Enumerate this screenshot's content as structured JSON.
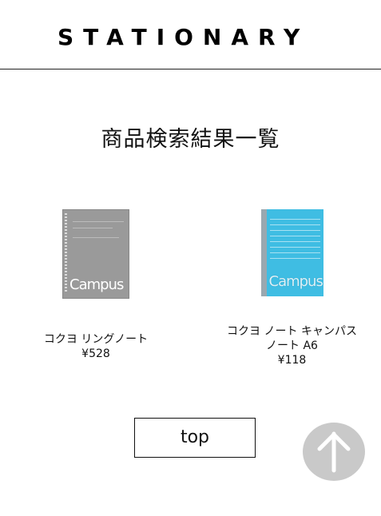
{
  "header": {
    "logo_text": "STATIONARY"
  },
  "page": {
    "title": "商品検索結果一覧"
  },
  "products": [
    {
      "name": "コクヨ リングノート",
      "price": "¥528",
      "cover_text": "Campus",
      "cover_color": "#9a9a9a"
    },
    {
      "name": "コクヨ ノート キャンパスノート A6",
      "price": "¥118",
      "cover_text": "Campus",
      "cover_color": "#3fbde3"
    }
  ],
  "footer": {
    "top_button_label": "top",
    "scroll_top_icon": "arrow-up-icon",
    "scroll_top_color": "#c9c9c9"
  }
}
